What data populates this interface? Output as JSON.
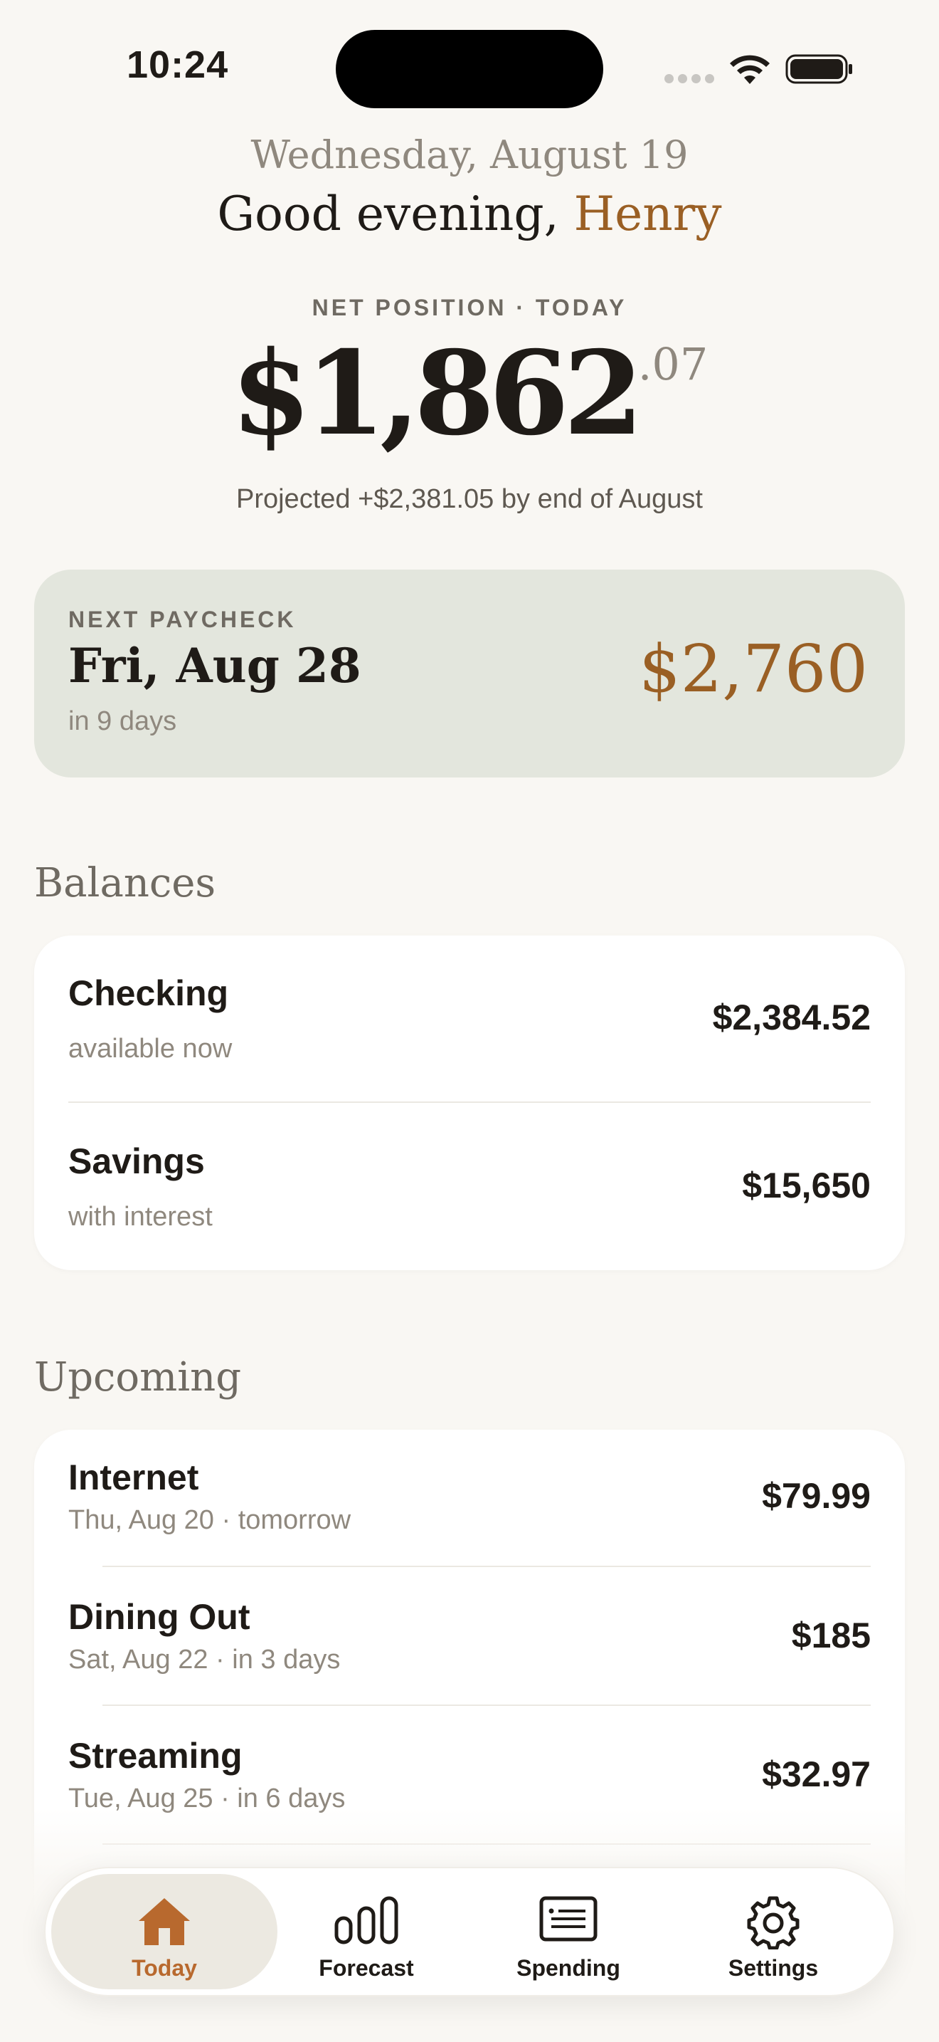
{
  "status_bar": {
    "time": "10:24"
  },
  "header": {
    "date": "Wednesday, August 19",
    "greeting_prefix": "Good evening,",
    "name": "Henry"
  },
  "net_position": {
    "label": "NET POSITION · TODAY",
    "amount_main": "$1,862",
    "amount_cents": ".07",
    "projected": "Projected +$2,381.05 by end of August"
  },
  "paycheck": {
    "label": "NEXT PAYCHECK",
    "date": "Fri, Aug 28",
    "sub": "in 9 days",
    "amount": "$2,760"
  },
  "balances": {
    "title": "Balances",
    "items": [
      {
        "label": "Checking",
        "sub": "available now",
        "amount": "$2,384.52"
      },
      {
        "label": "Savings",
        "sub": "with interest",
        "amount": "$15,650"
      }
    ]
  },
  "upcoming": {
    "title": "Upcoming",
    "items": [
      {
        "label": "Internet",
        "sub": "Thu, Aug 20 · tomorrow",
        "amount": "$79.99"
      },
      {
        "label": "Dining Out",
        "sub": "Sat, Aug 22 · in 3 days",
        "amount": "$185"
      },
      {
        "label": "Streaming",
        "sub": "Tue, Aug 25 · in 6 days",
        "amount": "$32.97"
      }
    ]
  },
  "tabbar": {
    "tabs": [
      {
        "label": "Today",
        "icon": "home-icon",
        "active": true
      },
      {
        "label": "Forecast",
        "icon": "bar-chart-icon",
        "active": false
      },
      {
        "label": "Spending",
        "icon": "receipt-icon",
        "active": false
      },
      {
        "label": "Settings",
        "icon": "gear-icon",
        "active": false
      }
    ]
  },
  "colors": {
    "background": "#f9f7f3",
    "accent": "#9a5f24",
    "tab_active": "#b8692e",
    "paycheck_card": "#e3e6dd"
  }
}
